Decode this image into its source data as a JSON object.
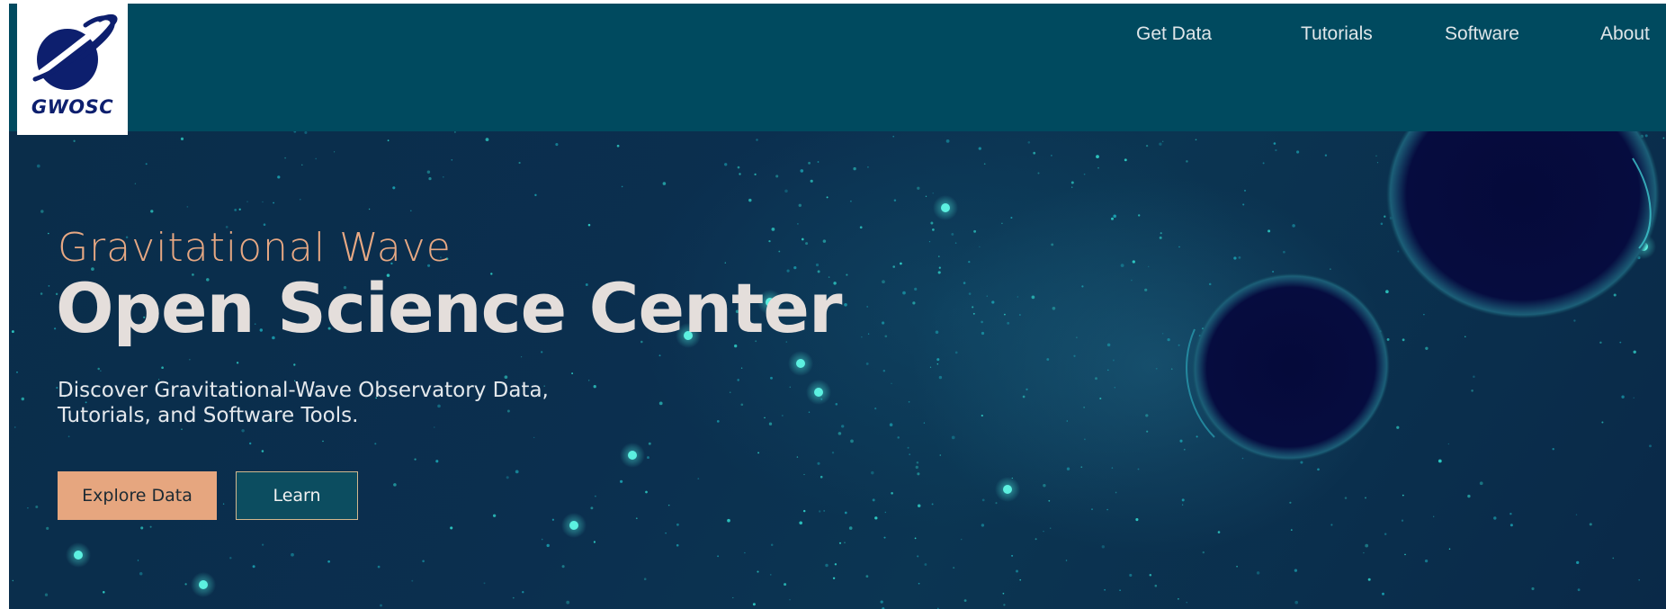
{
  "brand": {
    "logo_text": "GWOSC"
  },
  "nav": {
    "items": [
      {
        "label": "Get Data"
      },
      {
        "label": "Tutorials"
      },
      {
        "label": "Software"
      },
      {
        "label": "About"
      }
    ]
  },
  "hero": {
    "subtitle": "Gravitational Wave",
    "title": "Open Science Center",
    "description": "Discover Gravitational-Wave Observatory Data, Tutorials, and Software Tools.",
    "buttons": {
      "explore_label": "Explore Data",
      "learn_label": "Learn"
    }
  },
  "colors": {
    "header_bg": "#004a5f",
    "accent_orange": "#e6a67f",
    "logo_navy": "#0d1f6e",
    "hero_title": "#e4dedb"
  },
  "icons": {
    "logo": "planet-ring-logo-icon",
    "hero_bg": "binary-black-holes-starfield"
  }
}
